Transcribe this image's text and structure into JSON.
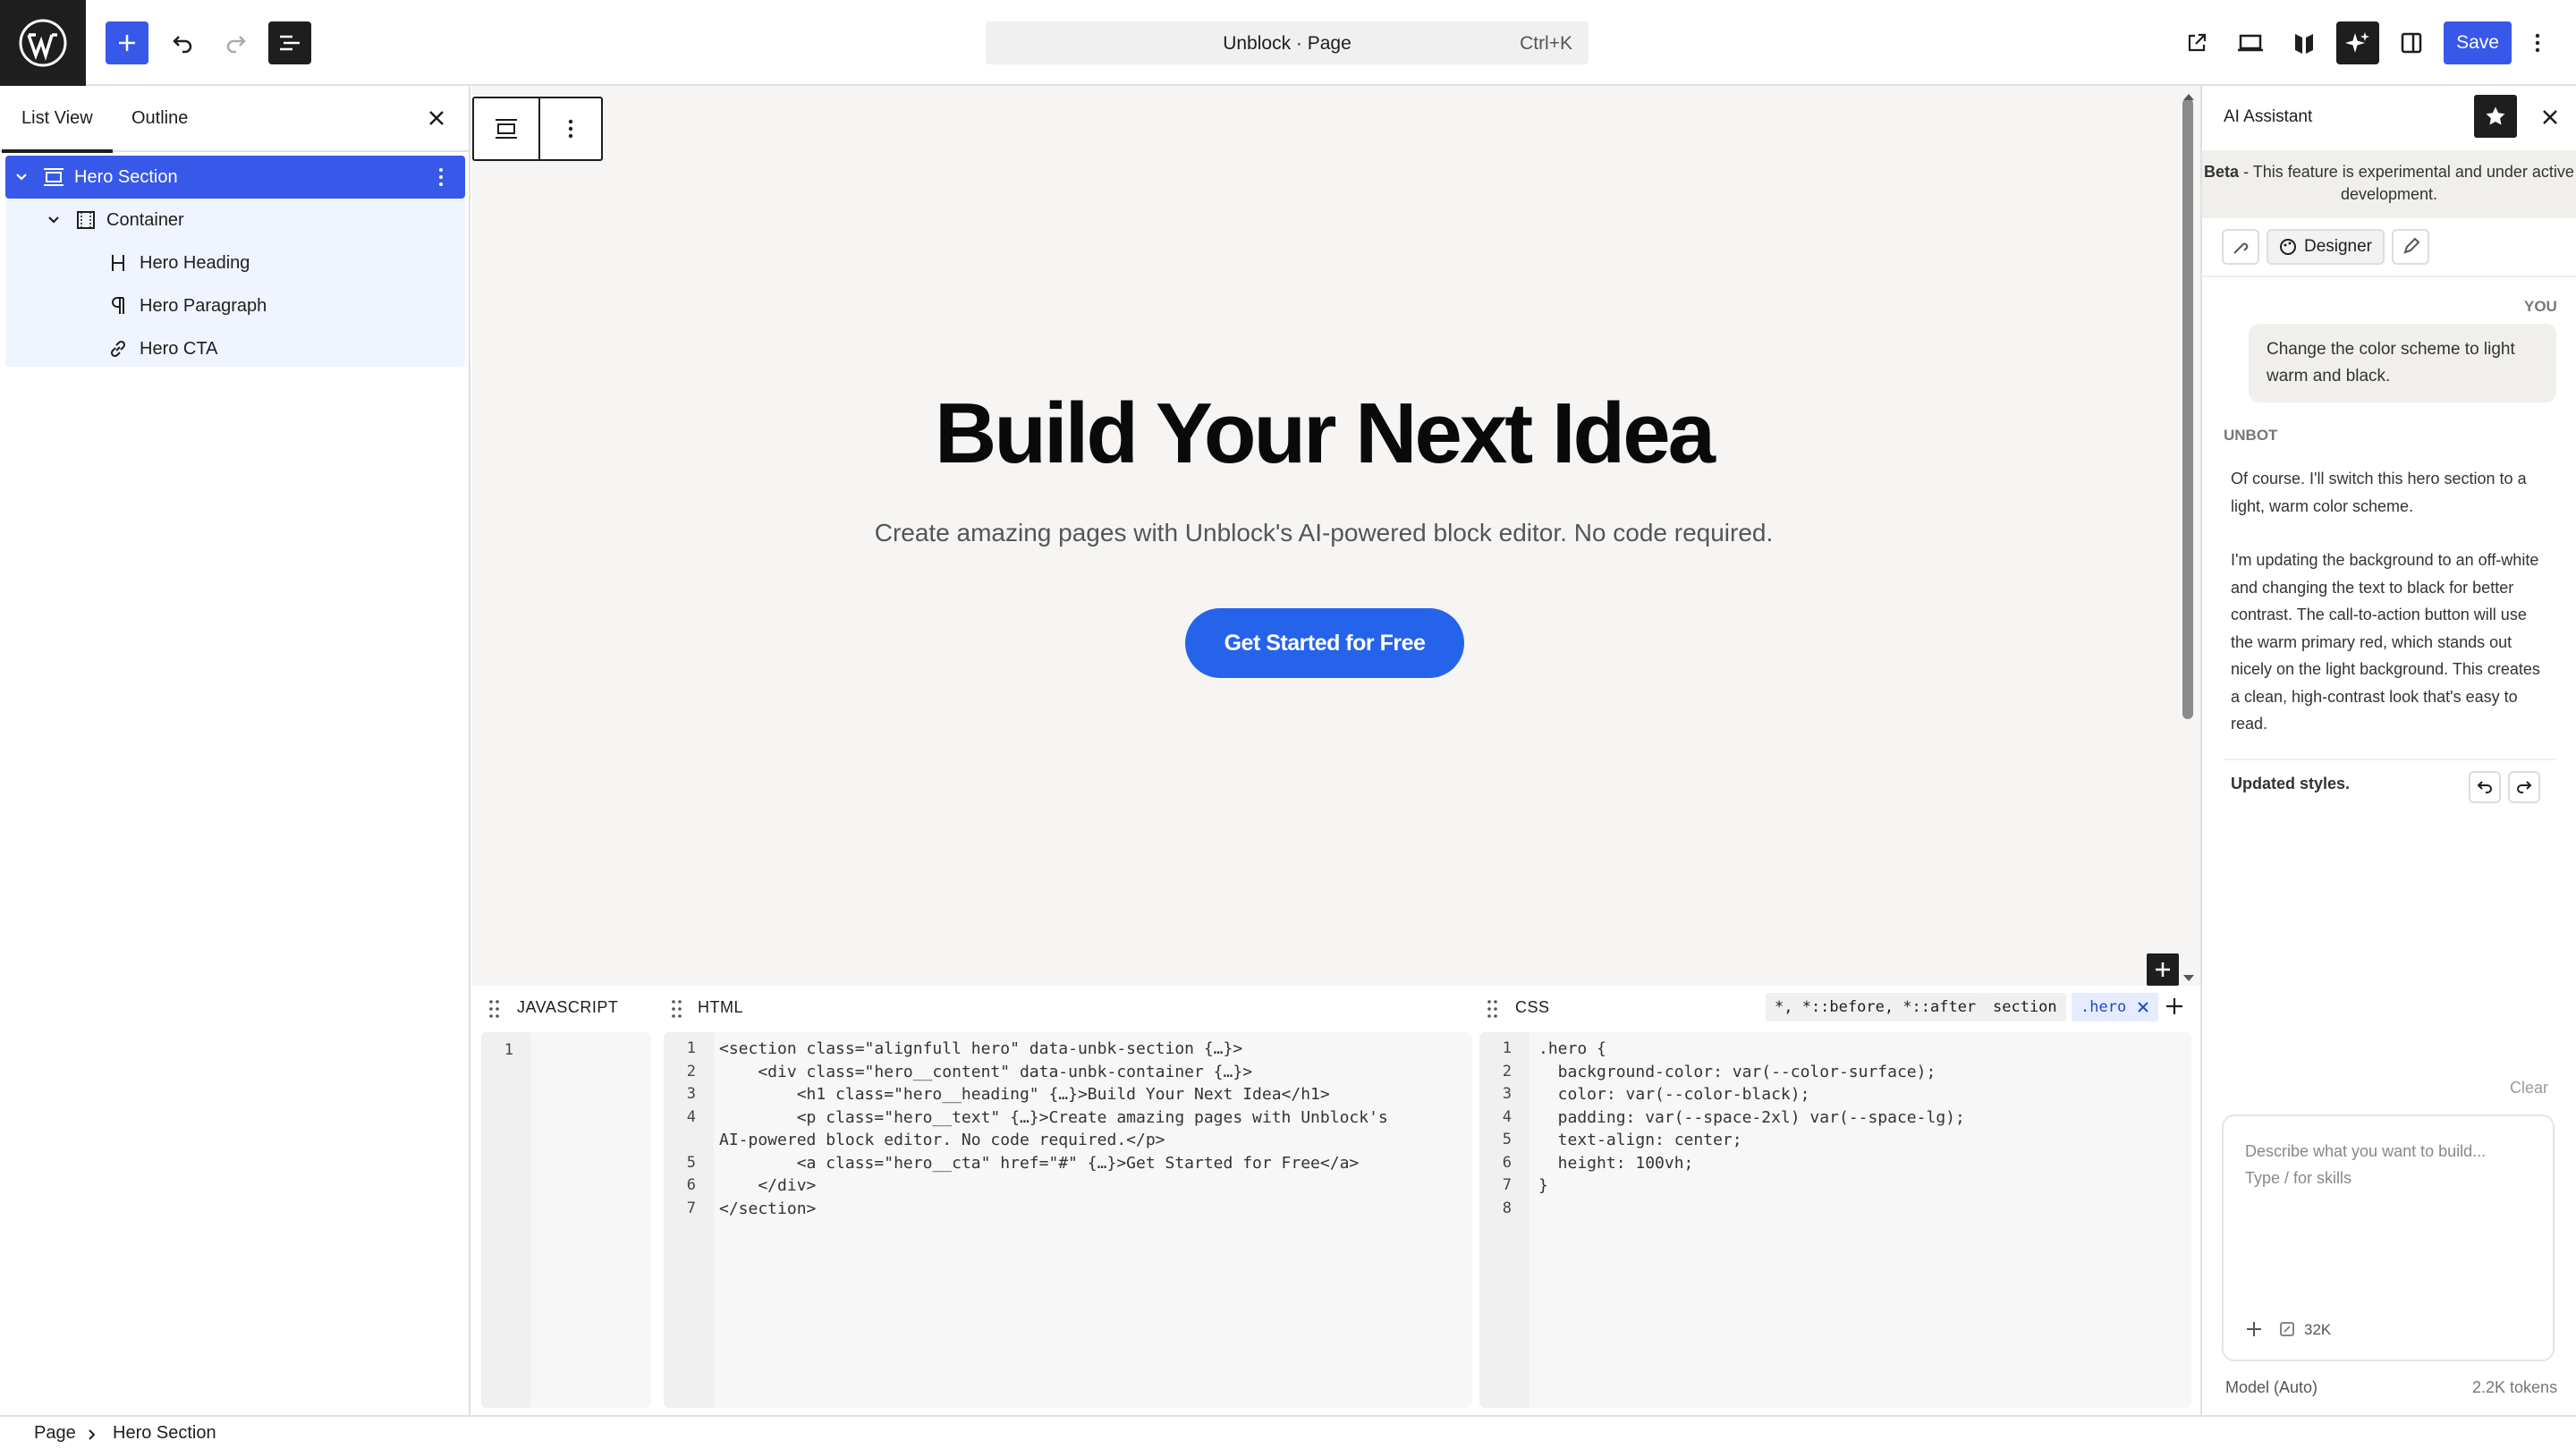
{
  "topbar": {
    "command_title": "Unblock · Page",
    "command_shortcut": "Ctrl+K",
    "save_label": "Save"
  },
  "sidebar": {
    "tabs": [
      "List View",
      "Outline"
    ],
    "tree": [
      {
        "label": "Hero Section",
        "icon": "section-icon"
      },
      {
        "label": "Container",
        "icon": "container-icon"
      },
      {
        "label": "Hero Heading",
        "icon": "heading-icon"
      },
      {
        "label": "Hero Paragraph",
        "icon": "paragraph-icon"
      },
      {
        "label": "Hero CTA",
        "icon": "link-icon"
      }
    ]
  },
  "canvas": {
    "heading": "Build Your Next Idea",
    "paragraph": "Create amazing pages with Unblock's AI-powered block editor. No code required.",
    "cta": "Get Started for Free"
  },
  "panels": {
    "js_title": "JAVASCRIPT",
    "html_title": "HTML",
    "css_title": "CSS",
    "js_lines": [
      "1"
    ],
    "css_chips": [
      "*, *::before, *::after",
      "section",
      ".hero"
    ],
    "html_code": [
      {
        "n": "1",
        "t": "<section class=\"alignfull hero\" data-unbk-section {…}>"
      },
      {
        "n": "2",
        "t": "    <div class=\"hero__content\" data-unbk-container {…}>"
      },
      {
        "n": "3",
        "t": "        <h1 class=\"hero__heading\" {…}>Build Your Next Idea</h1>"
      },
      {
        "n": "4",
        "t": "        <p class=\"hero__text\" {…}>Create amazing pages with Unblock's"
      },
      {
        "n": "",
        "t": "AI-powered block editor. No code required.</p>"
      },
      {
        "n": "5",
        "t": "        <a class=\"hero__cta\" href=\"#\" {…}>Get Started for Free</a>"
      },
      {
        "n": "6",
        "t": "    </div>"
      },
      {
        "n": "7",
        "t": "</section>"
      }
    ],
    "css_code": [
      {
        "n": "1",
        "t": ".hero {"
      },
      {
        "n": "2",
        "t": "  background-color: var(--color-surface);"
      },
      {
        "n": "3",
        "t": "  color: var(--color-black);"
      },
      {
        "n": "4",
        "t": "  padding: var(--space-2xl) var(--space-lg);"
      },
      {
        "n": "5",
        "t": "  text-align: center;"
      },
      {
        "n": "6",
        "t": "  height: 100vh;"
      },
      {
        "n": "7",
        "t": "}"
      },
      {
        "n": "8",
        "t": ""
      }
    ]
  },
  "assistant": {
    "title": "AI Assistant",
    "beta_bold": "Beta",
    "beta_text": " - This feature is experimental and under active development.",
    "mode_label": "Designer",
    "you_label": "YOU",
    "user_message": "Change the color scheme to light warm and black.",
    "bot_label": "UNBOT",
    "bot_p1": "Of course. I'll switch this hero section to a light, warm color scheme.",
    "bot_p2": "I'm updating the background to an off-white and changing the text to black for better contrast. The call-to-action button will use the warm primary red, which stands out nicely on the light background. This creates a clean, high-contrast look that's easy to read.",
    "updated": "Updated styles.",
    "clear": "Clear",
    "input_placeholder_1": "Describe what you want to build...",
    "input_placeholder_2": "Type / for skills",
    "context_count": "32K",
    "model": "Model (Auto)",
    "tokens": "2.2K tokens"
  },
  "breadcrumb": [
    "Page",
    "Hero Section"
  ],
  "colors": {
    "accent": "#3858e9",
    "cta": "#2563eb",
    "dark": "#1e1e1e",
    "canvas_bg": "#f6f5f3"
  }
}
